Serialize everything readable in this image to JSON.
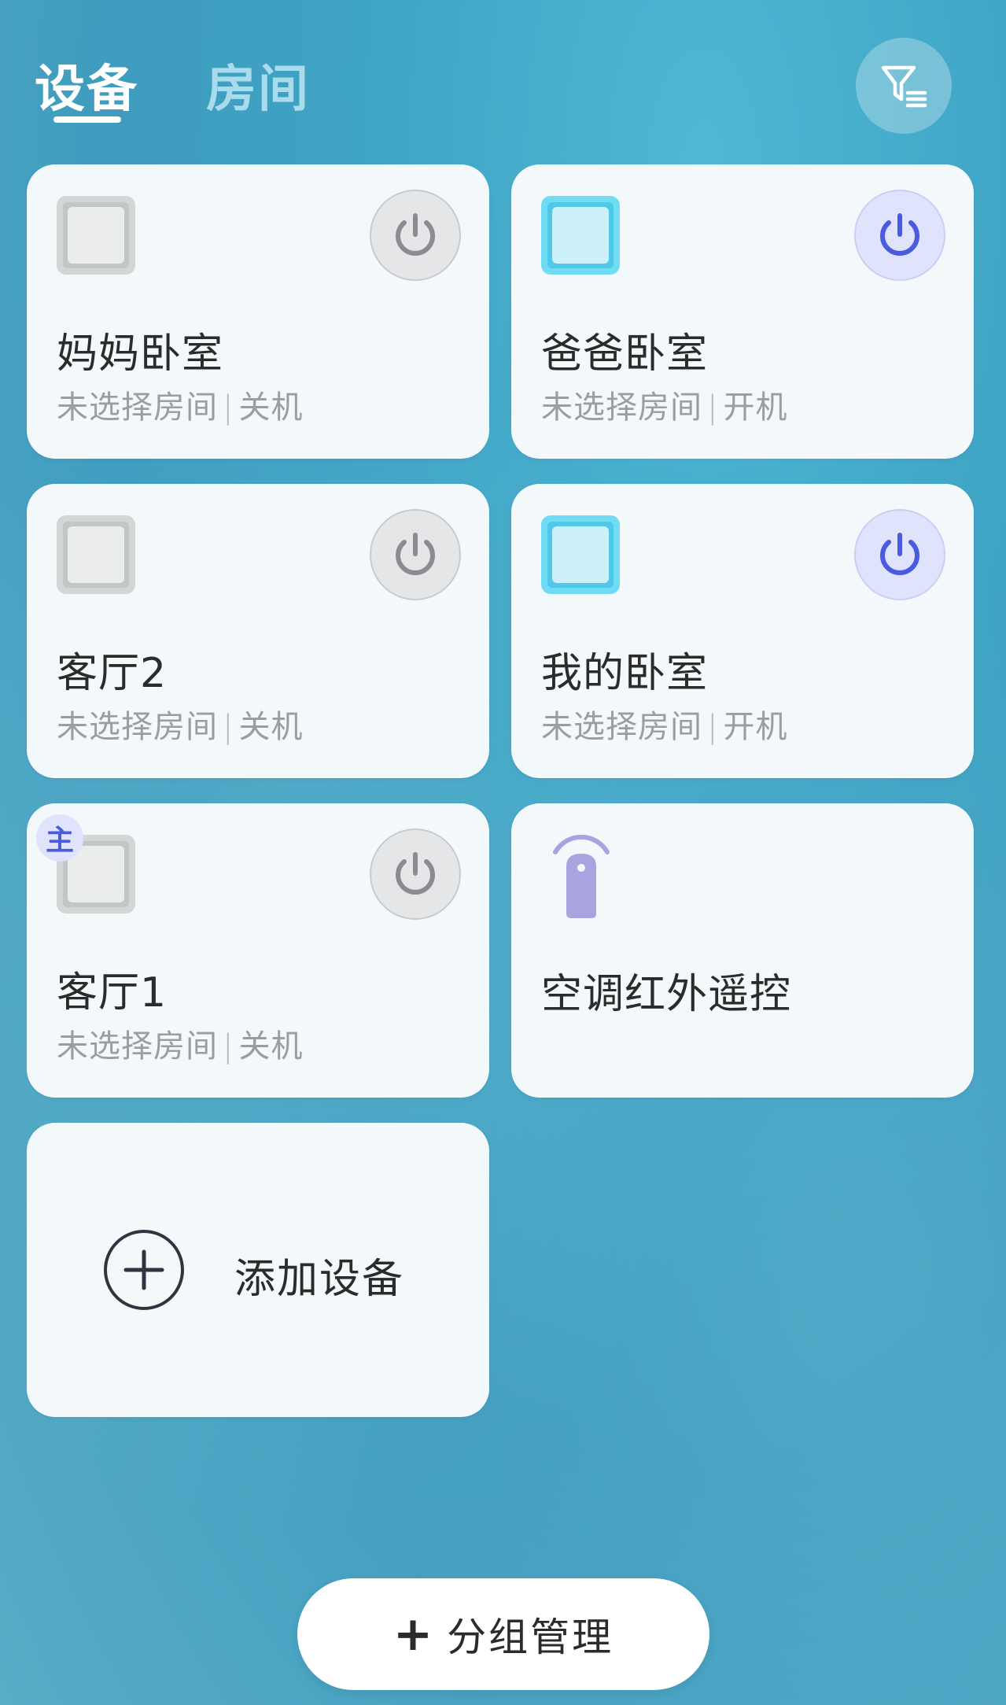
{
  "header": {
    "tabs": [
      {
        "label": "设备",
        "active": true
      },
      {
        "label": "房间",
        "active": false
      }
    ],
    "filter_icon": "filter-list-icon"
  },
  "devices": [
    {
      "name": "妈妈卧室",
      "room": "未选择房间",
      "separator": "|",
      "state": "关机",
      "power": "off",
      "icon": "ac-unit-icon"
    },
    {
      "name": "爸爸卧室",
      "room": "未选择房间",
      "separator": "|",
      "state": "开机",
      "power": "on",
      "icon": "ac-unit-icon"
    },
    {
      "name": "客厅2",
      "room": "未选择房间",
      "separator": "|",
      "state": "关机",
      "power": "off",
      "icon": "ac-unit-icon"
    },
    {
      "name": "我的卧室",
      "room": "未选择房间",
      "separator": "|",
      "state": "开机",
      "power": "on",
      "icon": "ac-unit-icon"
    },
    {
      "name": "客厅1",
      "room": "未选择房间",
      "separator": "|",
      "state": "关机",
      "power": "off",
      "icon": "ac-unit-icon",
      "badge": "主"
    },
    {
      "name": "空调红外遥控",
      "icon": "ir-remote-icon"
    }
  ],
  "add_device": {
    "label": "添加设备",
    "icon": "plus-circle-icon"
  },
  "group_manage": {
    "label": "分组管理",
    "plus": "+"
  },
  "colors": {
    "accent_on": "#4b5be0",
    "power_off": "#8a8c8f",
    "device_on": "#5fd3ef",
    "device_off": "#d4d6d6",
    "remote": "#a8a4e0"
  }
}
